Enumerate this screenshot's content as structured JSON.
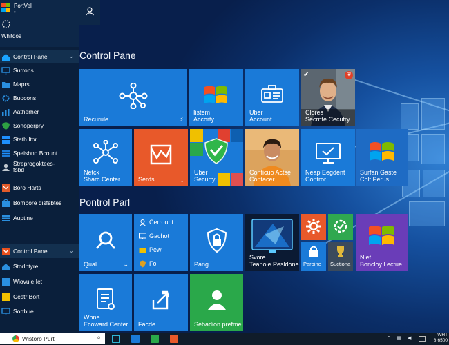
{
  "sidebar": {
    "top_apps": [
      {
        "label": "PortVel\n•"
      },
      {
        "label": "Whitdos"
      }
    ],
    "items": [
      {
        "label": "Control Pane",
        "chevron": "⌄",
        "icon": "home-icon",
        "color": "#1aa3ff"
      },
      {
        "label": "Surrons",
        "icon": "monitor-icon",
        "color": "#2a8fe0"
      },
      {
        "label": "Maprs",
        "icon": "folder-icon",
        "color": "#2a8fe0"
      },
      {
        "label": "Buocons",
        "icon": "gear-icon",
        "color": "#2a8fe0"
      },
      {
        "label": "Aatherher",
        "icon": "chart-icon",
        "color": "#2a8fe0"
      },
      {
        "label": "Sonoperpry",
        "icon": "shield-icon",
        "color": "#2ea043"
      },
      {
        "label": "Stath Itor",
        "icon": "windows-icon",
        "color": "#1e90ff"
      },
      {
        "label": "Speisbnd Bcount",
        "icon": "bars-icon",
        "color": "#1e90ff"
      },
      {
        "label": "Streprogoktees-\nfsbd",
        "icon": "user-icon",
        "color": "#c0c8d0"
      },
      {
        "label": "Boro Harts",
        "icon": "app-icon",
        "color": "#e05a2a"
      },
      {
        "label": "Bombore disfsbtes",
        "icon": "store-icon",
        "color": "#2a8fe0"
      },
      {
        "label": "Auptine",
        "icon": "list-icon",
        "color": "#2a8fe0"
      },
      {
        "label": "Control Pane",
        "chevron": "⌄",
        "icon": "app-icon",
        "color": "#e8501e"
      },
      {
        "label": "Storlbtyre",
        "icon": "home-icon",
        "color": "#2a8fe0"
      },
      {
        "label": "Wiovule Iet",
        "icon": "windows-icon",
        "color": "#2a8fe0"
      },
      {
        "label": "Cestr Bort",
        "icon": "windows-icon",
        "color": "#f0c000"
      },
      {
        "label": "Sortbue",
        "icon": "monitor-icon",
        "color": "#2a8fe0"
      }
    ]
  },
  "groups": {
    "first": "Control Pane",
    "second": "Pontrol Parl"
  },
  "tiles": {
    "recurule": "Recurule",
    "system": "Iistem\nAccorty",
    "uber_account": "Uber\nAccount",
    "clores": "Clores\nSecrnfe Cecutry",
    "network": "Netck\nSharc Center",
    "serds": "Serds",
    "uber_security": "Uber\nSecurty",
    "contacts": "Conficuo Actse\nContacer",
    "neap": "Neap Eegdent\nContror",
    "surfan": "Surfan Gaste\nChlt Perus",
    "qual": "Qual",
    "mini1": "Cerrount",
    "mini2": "Gachot",
    "mini3": "Pew",
    "mini4": "Fol",
    "pang": "Pang",
    "svore": "Svore\nTeanole Pesldone",
    "paroine": "Paroine",
    "suctiona": "Suctiona",
    "nief": "Nief\nBoncloy l ectue",
    "whne": "Whne\nEcoward Center",
    "facde": "Facde",
    "sebadion": "Sebadion prefme"
  },
  "taskbar": {
    "search": "Wistoro Purt",
    "time": "WHT",
    "date": "8·6500"
  }
}
